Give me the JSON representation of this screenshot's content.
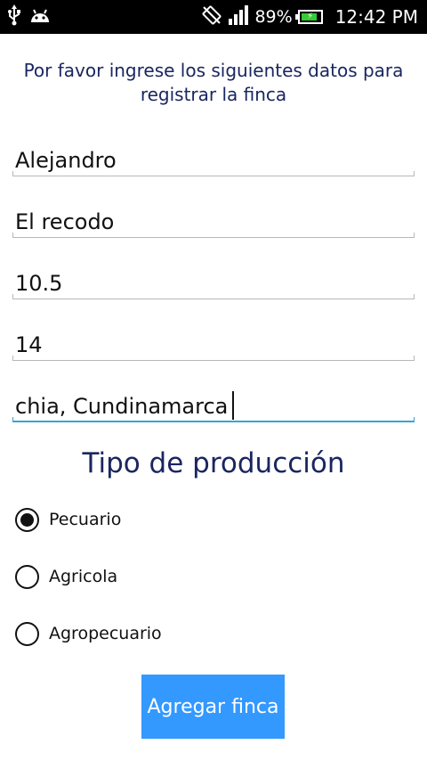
{
  "status_bar": {
    "battery_percent": "89%",
    "time": "12:42 PM",
    "icons": [
      "usb-icon",
      "android-icon",
      "screen-rotation-icon",
      "signal-icon",
      "battery-charging-icon"
    ]
  },
  "form": {
    "instructions": "Por favor ingrese los siguientes datos para registrar la finca",
    "fields": [
      {
        "value": "Alejandro"
      },
      {
        "value": "El recodo"
      },
      {
        "value": "10.5"
      },
      {
        "value": "14"
      },
      {
        "value": "chia, Cundinamarca"
      }
    ],
    "production_title": "Tipo de producción",
    "production_options": [
      {
        "label": "Pecuario",
        "selected": true
      },
      {
        "label": "Agricola",
        "selected": false
      },
      {
        "label": "Agropecuario",
        "selected": false
      }
    ],
    "submit_label": "Agregar finca"
  },
  "colors": {
    "heading_text": "#1a2660",
    "focus_underline": "#33a7d4",
    "button_bg": "#3399ff",
    "status_bar_bg": "#000000"
  }
}
